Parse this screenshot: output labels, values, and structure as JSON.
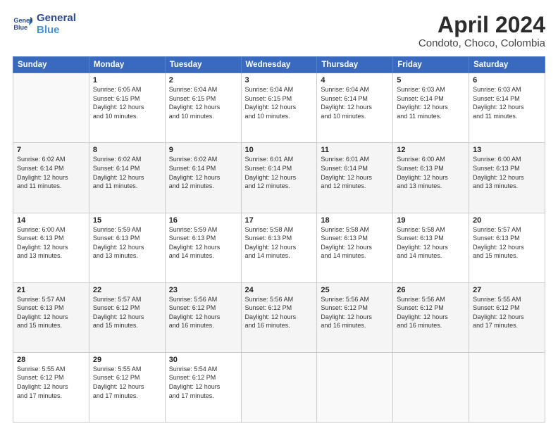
{
  "logo": {
    "line1": "General",
    "line2": "Blue"
  },
  "title": "April 2024",
  "subtitle": "Condoto, Choco, Colombia",
  "headers": [
    "Sunday",
    "Monday",
    "Tuesday",
    "Wednesday",
    "Thursday",
    "Friday",
    "Saturday"
  ],
  "weeks": [
    [
      {
        "day": "",
        "sunrise": "",
        "sunset": "",
        "daylight": ""
      },
      {
        "day": "1",
        "sunrise": "Sunrise: 6:05 AM",
        "sunset": "Sunset: 6:15 PM",
        "daylight": "Daylight: 12 hours and 10 minutes."
      },
      {
        "day": "2",
        "sunrise": "Sunrise: 6:04 AM",
        "sunset": "Sunset: 6:15 PM",
        "daylight": "Daylight: 12 hours and 10 minutes."
      },
      {
        "day": "3",
        "sunrise": "Sunrise: 6:04 AM",
        "sunset": "Sunset: 6:15 PM",
        "daylight": "Daylight: 12 hours and 10 minutes."
      },
      {
        "day": "4",
        "sunrise": "Sunrise: 6:04 AM",
        "sunset": "Sunset: 6:14 PM",
        "daylight": "Daylight: 12 hours and 10 minutes."
      },
      {
        "day": "5",
        "sunrise": "Sunrise: 6:03 AM",
        "sunset": "Sunset: 6:14 PM",
        "daylight": "Daylight: 12 hours and 11 minutes."
      },
      {
        "day": "6",
        "sunrise": "Sunrise: 6:03 AM",
        "sunset": "Sunset: 6:14 PM",
        "daylight": "Daylight: 12 hours and 11 minutes."
      }
    ],
    [
      {
        "day": "7",
        "sunrise": "Sunrise: 6:02 AM",
        "sunset": "Sunset: 6:14 PM",
        "daylight": "Daylight: 12 hours and 11 minutes."
      },
      {
        "day": "8",
        "sunrise": "Sunrise: 6:02 AM",
        "sunset": "Sunset: 6:14 PM",
        "daylight": "Daylight: 12 hours and 11 minutes."
      },
      {
        "day": "9",
        "sunrise": "Sunrise: 6:02 AM",
        "sunset": "Sunset: 6:14 PM",
        "daylight": "Daylight: 12 hours and 12 minutes."
      },
      {
        "day": "10",
        "sunrise": "Sunrise: 6:01 AM",
        "sunset": "Sunset: 6:14 PM",
        "daylight": "Daylight: 12 hours and 12 minutes."
      },
      {
        "day": "11",
        "sunrise": "Sunrise: 6:01 AM",
        "sunset": "Sunset: 6:14 PM",
        "daylight": "Daylight: 12 hours and 12 minutes."
      },
      {
        "day": "12",
        "sunrise": "Sunrise: 6:00 AM",
        "sunset": "Sunset: 6:13 PM",
        "daylight": "Daylight: 12 hours and 13 minutes."
      },
      {
        "day": "13",
        "sunrise": "Sunrise: 6:00 AM",
        "sunset": "Sunset: 6:13 PM",
        "daylight": "Daylight: 12 hours and 13 minutes."
      }
    ],
    [
      {
        "day": "14",
        "sunrise": "Sunrise: 6:00 AM",
        "sunset": "Sunset: 6:13 PM",
        "daylight": "Daylight: 12 hours and 13 minutes."
      },
      {
        "day": "15",
        "sunrise": "Sunrise: 5:59 AM",
        "sunset": "Sunset: 6:13 PM",
        "daylight": "Daylight: 12 hours and 13 minutes."
      },
      {
        "day": "16",
        "sunrise": "Sunrise: 5:59 AM",
        "sunset": "Sunset: 6:13 PM",
        "daylight": "Daylight: 12 hours and 14 minutes."
      },
      {
        "day": "17",
        "sunrise": "Sunrise: 5:58 AM",
        "sunset": "Sunset: 6:13 PM",
        "daylight": "Daylight: 12 hours and 14 minutes."
      },
      {
        "day": "18",
        "sunrise": "Sunrise: 5:58 AM",
        "sunset": "Sunset: 6:13 PM",
        "daylight": "Daylight: 12 hours and 14 minutes."
      },
      {
        "day": "19",
        "sunrise": "Sunrise: 5:58 AM",
        "sunset": "Sunset: 6:13 PM",
        "daylight": "Daylight: 12 hours and 14 minutes."
      },
      {
        "day": "20",
        "sunrise": "Sunrise: 5:57 AM",
        "sunset": "Sunset: 6:13 PM",
        "daylight": "Daylight: 12 hours and 15 minutes."
      }
    ],
    [
      {
        "day": "21",
        "sunrise": "Sunrise: 5:57 AM",
        "sunset": "Sunset: 6:13 PM",
        "daylight": "Daylight: 12 hours and 15 minutes."
      },
      {
        "day": "22",
        "sunrise": "Sunrise: 5:57 AM",
        "sunset": "Sunset: 6:12 PM",
        "daylight": "Daylight: 12 hours and 15 minutes."
      },
      {
        "day": "23",
        "sunrise": "Sunrise: 5:56 AM",
        "sunset": "Sunset: 6:12 PM",
        "daylight": "Daylight: 12 hours and 16 minutes."
      },
      {
        "day": "24",
        "sunrise": "Sunrise: 5:56 AM",
        "sunset": "Sunset: 6:12 PM",
        "daylight": "Daylight: 12 hours and 16 minutes."
      },
      {
        "day": "25",
        "sunrise": "Sunrise: 5:56 AM",
        "sunset": "Sunset: 6:12 PM",
        "daylight": "Daylight: 12 hours and 16 minutes."
      },
      {
        "day": "26",
        "sunrise": "Sunrise: 5:56 AM",
        "sunset": "Sunset: 6:12 PM",
        "daylight": "Daylight: 12 hours and 16 minutes."
      },
      {
        "day": "27",
        "sunrise": "Sunrise: 5:55 AM",
        "sunset": "Sunset: 6:12 PM",
        "daylight": "Daylight: 12 hours and 17 minutes."
      }
    ],
    [
      {
        "day": "28",
        "sunrise": "Sunrise: 5:55 AM",
        "sunset": "Sunset: 6:12 PM",
        "daylight": "Daylight: 12 hours and 17 minutes."
      },
      {
        "day": "29",
        "sunrise": "Sunrise: 5:55 AM",
        "sunset": "Sunset: 6:12 PM",
        "daylight": "Daylight: 12 hours and 17 minutes."
      },
      {
        "day": "30",
        "sunrise": "Sunrise: 5:54 AM",
        "sunset": "Sunset: 6:12 PM",
        "daylight": "Daylight: 12 hours and 17 minutes."
      },
      {
        "day": "",
        "sunrise": "",
        "sunset": "",
        "daylight": ""
      },
      {
        "day": "",
        "sunrise": "",
        "sunset": "",
        "daylight": ""
      },
      {
        "day": "",
        "sunrise": "",
        "sunset": "",
        "daylight": ""
      },
      {
        "day": "",
        "sunrise": "",
        "sunset": "",
        "daylight": ""
      }
    ]
  ]
}
